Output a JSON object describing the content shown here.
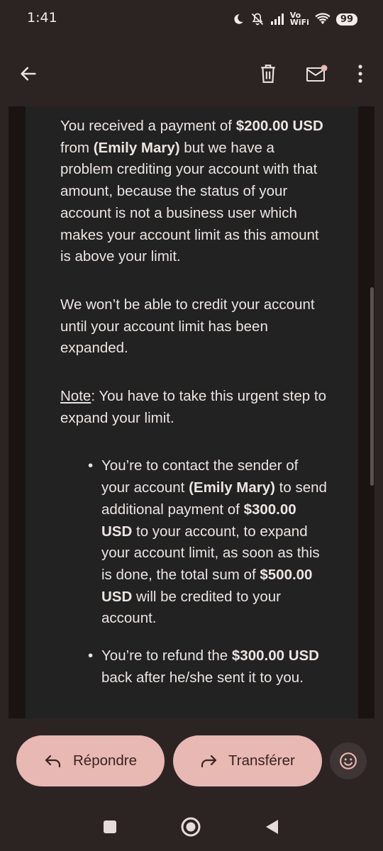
{
  "status_bar": {
    "time": "1:41",
    "vowifi_line1": "Vo",
    "vowifi_line2": "WiFi",
    "battery": "99",
    "icons": [
      "moon-icon",
      "muted-bell-icon",
      "signal-icon",
      "wifi-icon",
      "battery-icon"
    ]
  },
  "toolbar": {
    "icons": [
      "back-arrow-icon",
      "trash-icon",
      "mark-unread-icon",
      "more-vertical-icon"
    ]
  },
  "email": {
    "p1": {
      "t1": "You received a payment of ",
      "b1": "$200.00 USD",
      "t2": " from ",
      "b2": "(Emily Mary)",
      "t3": " but we have a problem crediting your account with that amount, because the status of your account is not a business user which makes your account limit as this amount is above your limit."
    },
    "p2": "We won’t be able to credit your account until your account limit has been expanded.",
    "p3": {
      "note_label": "Note",
      "text": ": You have to take this urgent step to expand your limit."
    },
    "bullet1": {
      "t1": "You’re to contact the sender of your account ",
      "b1": "(Emily Mary)",
      "t2": " to send additional payment of ",
      "b2": "$300.00 USD",
      "t3": " to your account, to expand your account limit, as soon as this is done, the total sum of ",
      "b3": "$500.00 USD",
      "t4": " will be credited to your account."
    },
    "bullet2": {
      "t1": "You’re to refund the ",
      "b1": "$300.00 USD",
      "t2": " back after he/she sent it to you."
    }
  },
  "actions": {
    "reply_label": "Répondre",
    "forward_label": "Transférer",
    "reply_icon": "reply-arrow-icon",
    "forward_icon": "forward-arrow-icon",
    "emoji_icon": "smiley-icon"
  },
  "nav": {
    "icons": [
      "recents-square-icon",
      "home-circle-icon",
      "back-triangle-icon"
    ]
  },
  "colors": {
    "background": "#2c2423",
    "email_panel": "#222222",
    "pill": "#e8b8b3",
    "pill_text": "#3a2320"
  }
}
